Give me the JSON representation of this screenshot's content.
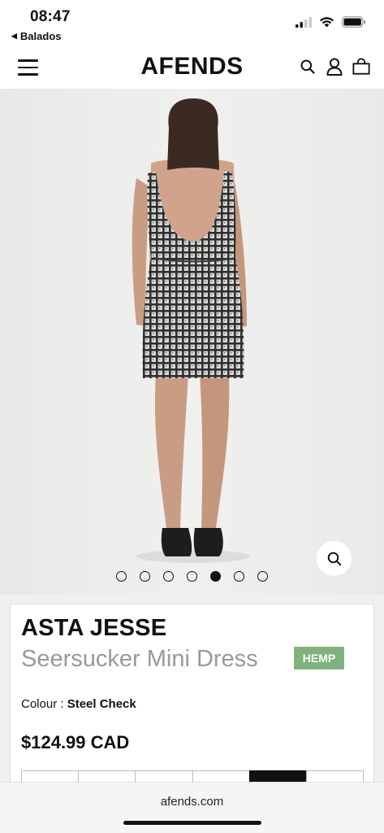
{
  "status_bar": {
    "time": "08:47",
    "back_label": "Balados",
    "icons": [
      "cellular-signal-icon",
      "wifi-icon",
      "battery-icon"
    ]
  },
  "nav": {
    "brand": "AFENDS",
    "icons": [
      "menu-icon",
      "search-icon",
      "account-icon",
      "bag-icon"
    ]
  },
  "gallery": {
    "image_count": 7,
    "active_index": 4,
    "zoom_icon": "zoom-icon"
  },
  "product": {
    "brand": "ASTA JESSE",
    "name": "Seersucker Mini Dress",
    "tag": "HEMP",
    "tag_color": "#7fb27e",
    "colour_label": "Colour :",
    "colour_value": "Steel Check",
    "price": "$124.99 CAD"
  },
  "browser": {
    "url": "afends.com"
  }
}
